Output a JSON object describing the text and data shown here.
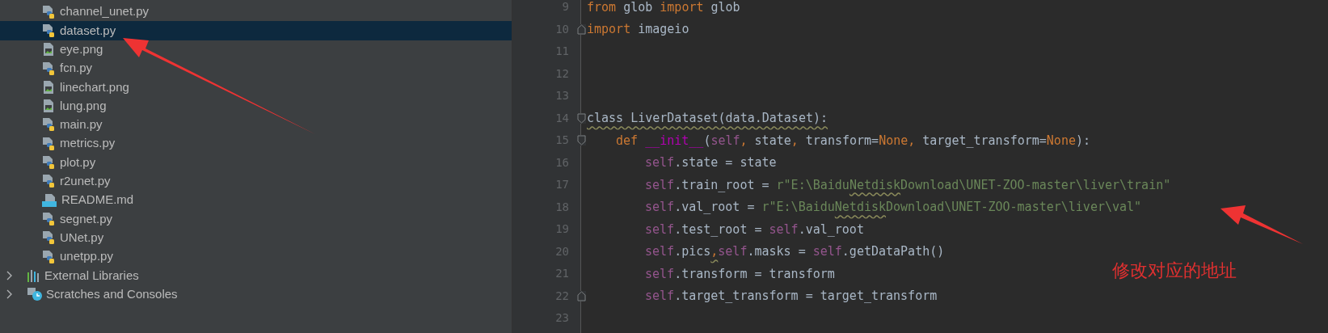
{
  "project_tree": {
    "files": [
      {
        "name": "channel_unet.py",
        "kind": "python",
        "selected": false
      },
      {
        "name": "dataset.py",
        "kind": "python",
        "selected": true
      },
      {
        "name": "eye.png",
        "kind": "image",
        "selected": false
      },
      {
        "name": "fcn.py",
        "kind": "python",
        "selected": false
      },
      {
        "name": "linechart.png",
        "kind": "image",
        "selected": false
      },
      {
        "name": "lung.png",
        "kind": "image",
        "selected": false
      },
      {
        "name": "main.py",
        "kind": "python",
        "selected": false
      },
      {
        "name": "metrics.py",
        "kind": "python",
        "selected": false
      },
      {
        "name": "plot.py",
        "kind": "python",
        "selected": false
      },
      {
        "name": "r2unet.py",
        "kind": "python",
        "selected": false
      },
      {
        "name": "README.md",
        "kind": "markdown",
        "selected": false
      },
      {
        "name": "segnet.py",
        "kind": "python",
        "selected": false
      },
      {
        "name": "UNet.py",
        "kind": "python",
        "selected": false
      },
      {
        "name": "unetpp.py",
        "kind": "python",
        "selected": false
      }
    ],
    "groups": [
      {
        "name": "External Libraries",
        "kind": "libraries",
        "expanded": false
      },
      {
        "name": "Scratches and Consoles",
        "kind": "scratches",
        "expanded": false
      }
    ]
  },
  "editor": {
    "lines": [
      {
        "number": "9",
        "kind": "top",
        "tokens": [
          {
            "text": "from",
            "kind": "keyword"
          },
          {
            "text": " glob ",
            "kind": "plain"
          },
          {
            "text": "import",
            "kind": "keyword"
          },
          {
            "text": " glob",
            "kind": "plain"
          }
        ]
      },
      {
        "number": "10",
        "kind": "top",
        "fold_close": true,
        "tokens": [
          {
            "text": "import",
            "kind": "keyword"
          },
          {
            "text": " imageio",
            "kind": "plain"
          }
        ]
      },
      {
        "number": "11",
        "kind": "top"
      },
      {
        "number": "12",
        "kind": "top"
      },
      {
        "number": "13",
        "kind": "top"
      },
      {
        "number": "14",
        "kind": "top",
        "fold_open": true,
        "tokens": [
          {
            "text": "class LiverDataset(data.Dataset):",
            "kind": "plain",
            "squiggle": true
          }
        ]
      },
      {
        "number": "15",
        "kind": "method",
        "fold_open": true,
        "tokens": [
          {
            "text": "def ",
            "kind": "keyword"
          },
          {
            "text": "__init__",
            "kind": "magic"
          },
          {
            "text": "(",
            "kind": "plain"
          },
          {
            "text": "self",
            "kind": "self"
          },
          {
            "text": ", ",
            "kind": "keyword"
          },
          {
            "text": "state",
            "kind": "plain"
          },
          {
            "text": ", ",
            "kind": "keyword"
          },
          {
            "text": "transform=",
            "kind": "plain"
          },
          {
            "text": "None",
            "kind": "keyword"
          },
          {
            "text": ", ",
            "kind": "keyword"
          },
          {
            "text": "target_transform=",
            "kind": "plain"
          },
          {
            "text": "None",
            "kind": "keyword"
          },
          {
            "text": "):",
            "kind": "plain"
          }
        ]
      },
      {
        "number": "16",
        "kind": "body",
        "tokens": [
          {
            "text": "self",
            "kind": "self"
          },
          {
            "text": ".state = state",
            "kind": "plain"
          }
        ]
      },
      {
        "number": "17",
        "kind": "body",
        "tokens": [
          {
            "text": "self",
            "kind": "self"
          },
          {
            "text": ".train_root = ",
            "kind": "plain"
          },
          {
            "text": "r\"E:\\Baidu",
            "kind": "string"
          },
          {
            "text": "Netdisk",
            "kind": "string",
            "squiggle": true
          },
          {
            "text": "Download\\UNET-ZOO-master\\liver\\train\"",
            "kind": "string"
          }
        ]
      },
      {
        "number": "18",
        "kind": "body",
        "tokens": [
          {
            "text": "self",
            "kind": "self"
          },
          {
            "text": ".val_root = ",
            "kind": "plain"
          },
          {
            "text": "r\"E:\\Baidu",
            "kind": "string"
          },
          {
            "text": "Netdisk",
            "kind": "string",
            "squiggle": true
          },
          {
            "text": "Download\\UNET-ZOO-master\\liver\\val\"",
            "kind": "string"
          }
        ]
      },
      {
        "number": "19",
        "kind": "body",
        "tokens": [
          {
            "text": "self",
            "kind": "self"
          },
          {
            "text": ".test_root = ",
            "kind": "plain"
          },
          {
            "text": "self",
            "kind": "self"
          },
          {
            "text": ".val_root",
            "kind": "plain"
          }
        ]
      },
      {
        "number": "20",
        "kind": "body",
        "tokens": [
          {
            "text": "self",
            "kind": "self"
          },
          {
            "text": ".pics",
            "kind": "plain"
          },
          {
            "text": ",",
            "kind": "keyword",
            "squiggle": true
          },
          {
            "text": "self",
            "kind": "self"
          },
          {
            "text": ".masks = ",
            "kind": "plain"
          },
          {
            "text": "self",
            "kind": "self"
          },
          {
            "text": ".getDataPath()",
            "kind": "plain"
          }
        ]
      },
      {
        "number": "21",
        "kind": "body",
        "tokens": [
          {
            "text": "self",
            "kind": "self"
          },
          {
            "text": ".transform = transform",
            "kind": "plain"
          }
        ]
      },
      {
        "number": "22",
        "kind": "body",
        "fold_close": true,
        "tokens": [
          {
            "text": "self",
            "kind": "self"
          },
          {
            "text": ".target_transform = target_transform",
            "kind": "plain"
          }
        ]
      },
      {
        "number": "23",
        "kind": "top"
      }
    ]
  },
  "annotation": {
    "note": "修改对应的地址"
  }
}
